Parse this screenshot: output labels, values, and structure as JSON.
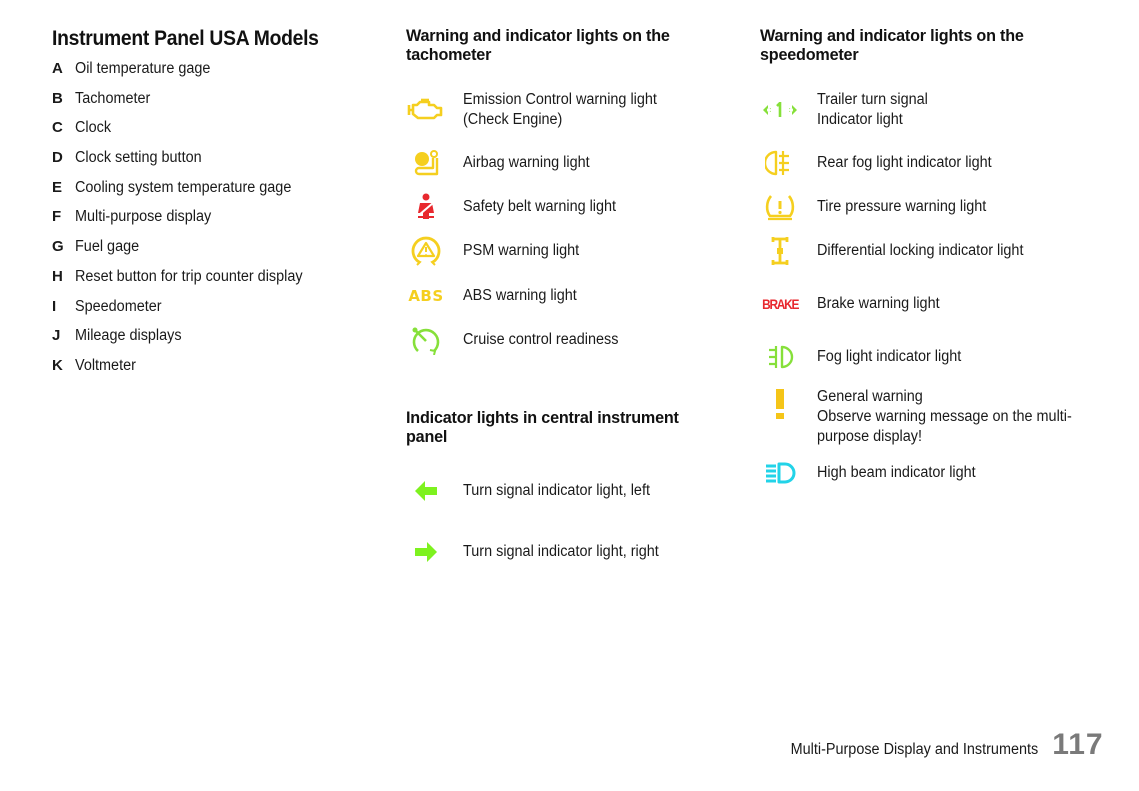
{
  "instrument_panel": {
    "title": "Instrument Panel USA Models",
    "items": [
      {
        "letter": "A",
        "label": "Oil temperature gage"
      },
      {
        "letter": "B",
        "label": "Tachometer"
      },
      {
        "letter": "C",
        "label": "Clock"
      },
      {
        "letter": "D",
        "label": "Clock setting button"
      },
      {
        "letter": "E",
        "label": "Cooling system temperature gage"
      },
      {
        "letter": "F",
        "label": "Multi-purpose display"
      },
      {
        "letter": "G",
        "label": "Fuel gage"
      },
      {
        "letter": "H",
        "label": "Reset button for trip counter display"
      },
      {
        "letter": "I",
        "label": "Speedometer"
      },
      {
        "letter": "J",
        "label": "Mileage displays"
      },
      {
        "letter": "K",
        "label": "Voltmeter"
      }
    ]
  },
  "tachometer_section": {
    "title_line1": "Warning and indicator lights on the",
    "title_line2": "tachometer",
    "lights": [
      {
        "icon": "check-engine-icon",
        "color": "#f5cf1f",
        "label": "Emission Control warning light",
        "label2": "(Check Engine)"
      },
      {
        "icon": "airbag-icon",
        "color": "#f5cf1f",
        "label": "Airbag warning light"
      },
      {
        "icon": "seatbelt-icon",
        "color": "#e8282e",
        "label": "Safety belt warning light"
      },
      {
        "icon": "psm-icon",
        "color": "#f5cf1f",
        "label": "PSM warning light"
      },
      {
        "icon": "abs-icon",
        "color": "#f5cf1f",
        "icon_text": "ABS",
        "label": "ABS warning light"
      },
      {
        "icon": "cruise-control-icon",
        "color": "#86e03a",
        "label": "Cruise control readiness"
      }
    ]
  },
  "central_section": {
    "title_line1": "Indicator lights in central instrument",
    "title_line2": "panel",
    "lights": [
      {
        "icon": "turn-left-arrow-icon",
        "color": "#7ef21f",
        "label": "Turn signal indicator light, left"
      },
      {
        "icon": "turn-right-arrow-icon",
        "color": "#7ef21f",
        "label": "Turn signal indicator light, right"
      }
    ]
  },
  "speedometer_section": {
    "title_line1": "Warning and indicator lights on the",
    "title_line2": "speedometer",
    "lights": [
      {
        "icon": "trailer-turn-signal-icon",
        "color": "#86e03a",
        "label": "Trailer turn signal",
        "label2": "Indicator light"
      },
      {
        "icon": "rear-fog-light-icon",
        "color": "#f5cf1f",
        "label": "Rear fog light indicator light"
      },
      {
        "icon": "tire-pressure-icon",
        "color": "#f5cf1f",
        "label": "Tire pressure warning light"
      },
      {
        "icon": "differential-lock-icon",
        "color": "#f5cf1f",
        "label": "Differential locking indicator light"
      },
      {
        "icon": "brake-icon",
        "color": "#e8282e",
        "icon_text": "BRAKE",
        "label": "Brake warning light"
      },
      {
        "icon": "fog-light-icon",
        "color": "#86e03a",
        "label": "Fog light indicator light"
      },
      {
        "icon": "general-warning-icon",
        "color": "#f5c518",
        "label": "General warning",
        "label2": "Observe warning message on the multi-",
        "label3": "purpose display!"
      },
      {
        "icon": "high-beam-icon",
        "color": "#22d3e8",
        "label": "High beam indicator light"
      }
    ]
  },
  "footer": {
    "section_title": "Multi-Purpose Display and Instruments",
    "page_number": "117"
  }
}
